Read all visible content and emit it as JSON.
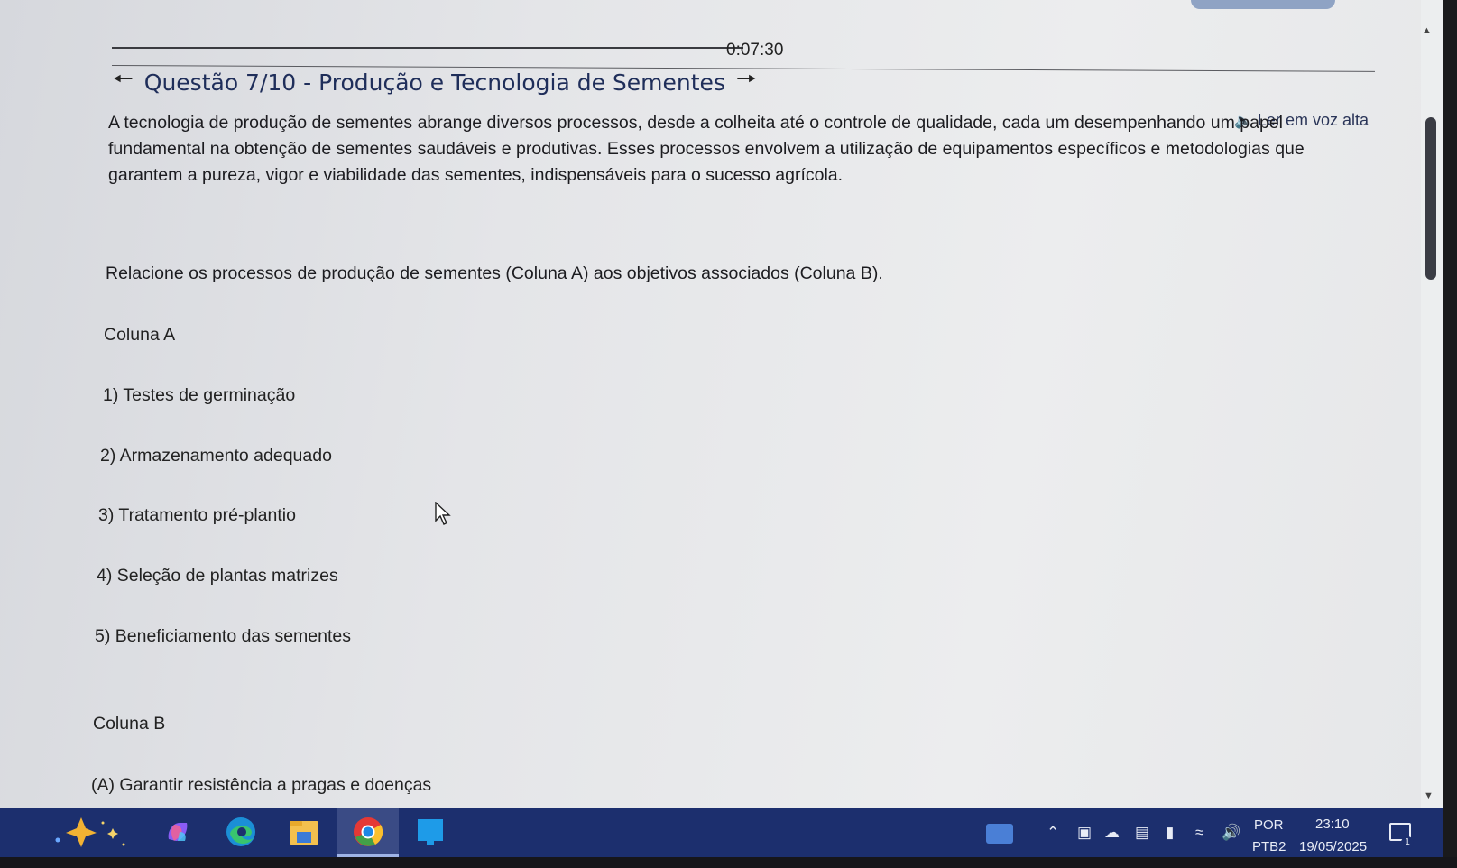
{
  "timer": "0:07:30",
  "question": {
    "title": "Questão 7/10 - Produção e Tecnologia de Sementes",
    "read_aloud": "Ler em voz alta",
    "intro_lines": [
      "A tecnologia de produção de sementes abrange diversos processos, desde a colheita até o controle de qualidade, cada um desempenhando um papel",
      "fundamental na obtenção de sementes saudáveis e produtivas. Esses processos envolvem a utilização de equipamentos específicos e metodologias que",
      "garantem a pureza, vigor e viabilidade das sementes, indispensáveis para o sucesso agrícola."
    ],
    "prompt": "Relacione os processos de produção de sementes (Coluna A) aos objetivos associados (Coluna B).",
    "column_a": {
      "heading": "Coluna A",
      "items": [
        "1) Testes de germinação",
        "2) Armazenamento adequado",
        "3) Tratamento pré-plantio",
        "4) Seleção de plantas matrizes",
        "5) Beneficiamento das sementes"
      ]
    },
    "column_b": {
      "heading": "Coluna B",
      "items": [
        "(A) Garantir resistência a pragas e doenças"
      ]
    }
  },
  "taskbar": {
    "apps": [
      "copilot-icon",
      "edge-icon",
      "file-explorer-icon",
      "chrome-icon",
      "app-icon"
    ],
    "tray": {
      "language_top": "POR",
      "language_bottom": "PTB2",
      "time": "23:10",
      "date": "19/05/2025",
      "notification_count": "1"
    }
  },
  "colors": {
    "taskbar": "#1c2f6e",
    "title": "#1f2e5a",
    "page": "#e6e7e9"
  }
}
